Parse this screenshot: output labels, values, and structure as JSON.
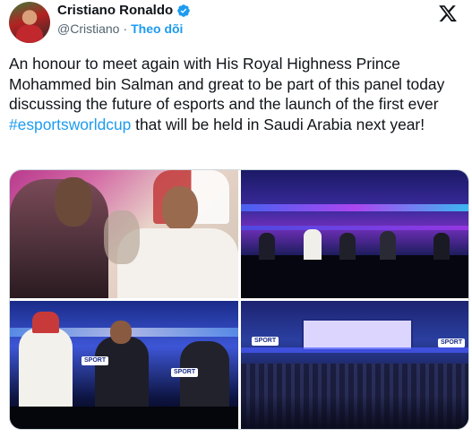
{
  "author": {
    "name": "Cristiano Ronaldo",
    "handle": "@Cristiano",
    "separator": "·",
    "follow_label": "Theo dõi",
    "verified": true
  },
  "tweet": {
    "text_before": "An honour to meet again with His Royal Highness Prince Mohammed bin Salman and great to be part of this panel today discussing the future of esports and the launch of the first ever ",
    "hashtag": "#esportsworldcup",
    "text_after": " that will be held in Saudi Arabia next year!"
  },
  "media": {
    "photos": [
      {
        "id": "photo-1",
        "badges": []
      },
      {
        "id": "photo-2",
        "badges": []
      },
      {
        "id": "photo-3",
        "badges": [
          "SPORT",
          "SPORT"
        ]
      },
      {
        "id": "photo-4",
        "badges": [
          "SPORT",
          "SPORT"
        ]
      }
    ]
  },
  "colors": {
    "accent": "#1d9bf0",
    "text": "#0f1419",
    "secondary": "#536471",
    "border": "#cfd9de"
  },
  "icons": {
    "verified": "verified-badge-icon",
    "platform": "x-logo-icon"
  }
}
